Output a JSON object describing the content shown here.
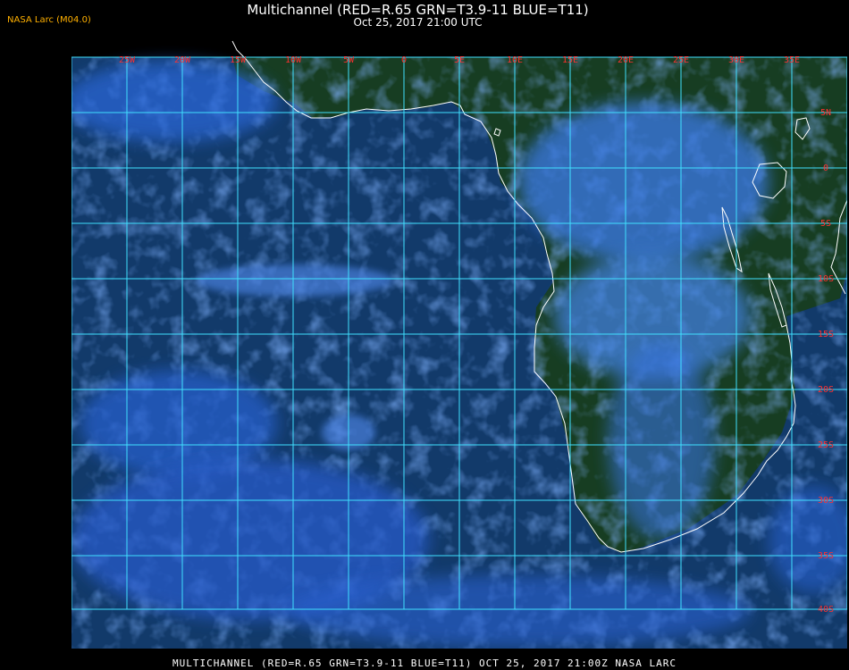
{
  "header": {
    "title": "Multichannel (RED=R.65 GRN=T3.9-11 BLUE=T11)",
    "subtitle": "Oct 25, 2017 21:00 UTC",
    "badge": "NASA Larc (M04.0)"
  },
  "footer": {
    "caption": "MULTICHANNEL (RED=R.65 GRN=T3.9-11 BLUE=T11) OCT 25, 2017 21:00Z   NASA LARC"
  },
  "colors": {
    "grid": "#40e0ff",
    "labels": "#ff3030",
    "coast": "#ffffff",
    "ocean": "#123a6a",
    "land": "#173d22",
    "cloud": "#3a7cff"
  },
  "grid": {
    "lon_labels": [
      "25W",
      "20W",
      "15W",
      "10W",
      "5W",
      "0",
      "5E",
      "10E",
      "15E",
      "20E",
      "25E",
      "30E",
      "35E"
    ],
    "lat_labels": [
      "5N",
      "0",
      "5S",
      "10S",
      "15S",
      "20S",
      "25S",
      "30S",
      "35S",
      "40S"
    ]
  }
}
